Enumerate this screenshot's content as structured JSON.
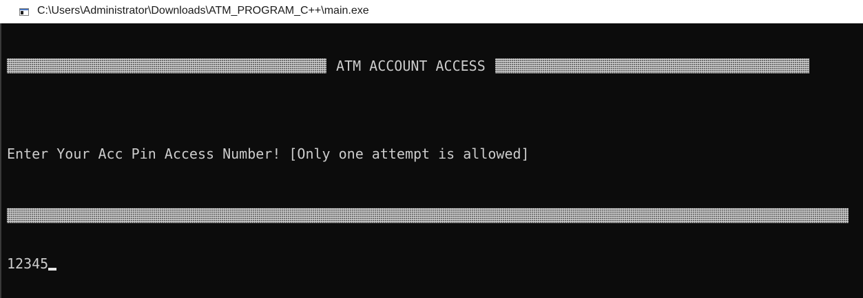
{
  "window": {
    "title": "C:\\Users\\Administrator\\Downloads\\ATM_PROGRAM_C++\\main.exe",
    "icon": "console-app-icon"
  },
  "console": {
    "banner_title": "ATM ACCOUNT ACCESS",
    "prompt": "Enter Your Acc Pin Access Number! [Only one attempt is allowed]",
    "input_value": "12345",
    "colors": {
      "background": "#0c0c0c",
      "text": "#cccccc"
    }
  }
}
